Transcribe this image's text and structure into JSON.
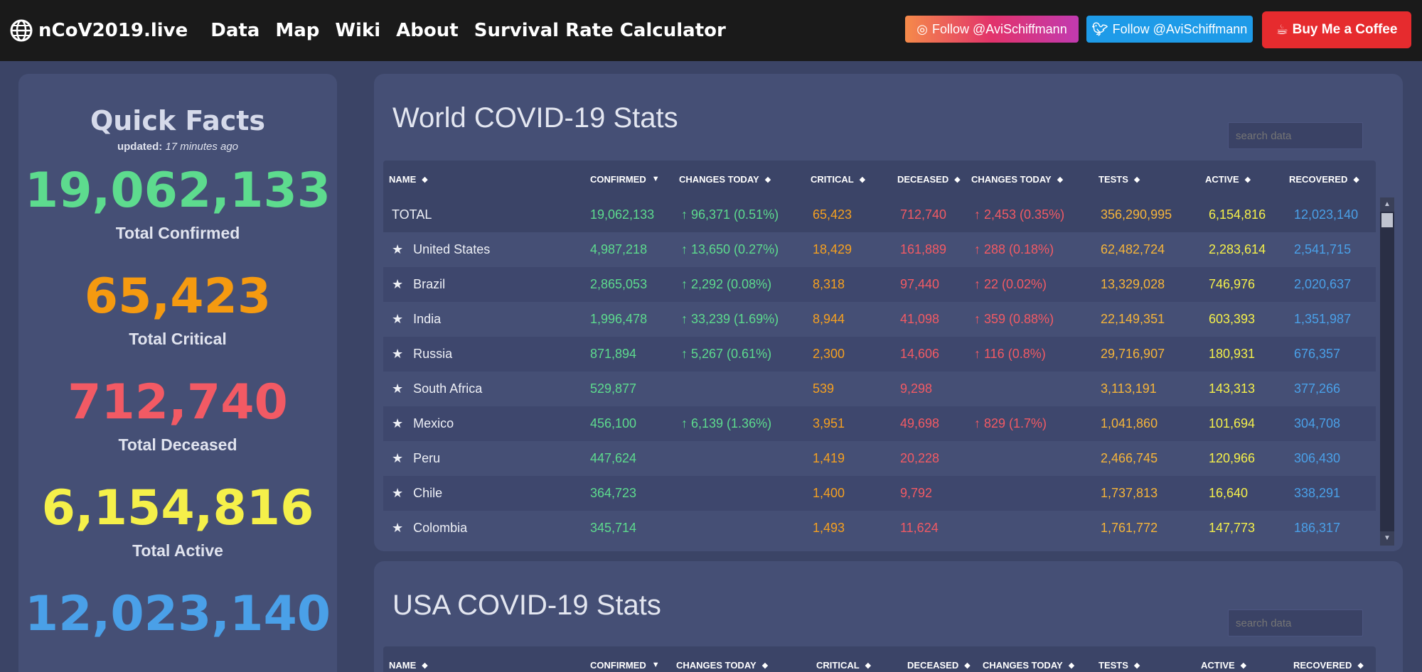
{
  "nav": {
    "brand": "nCoV2019.live",
    "links": [
      "Data",
      "Map",
      "Wiki",
      "About",
      "Survival Rate Calculator"
    ],
    "instagram_label": "Follow @AviSchiffmann",
    "twitter_label": "Follow @AviSchiffmann",
    "coffee_label": "Buy Me a Coffee"
  },
  "quick_facts": {
    "title": "Quick Facts",
    "updated_prefix": "updated:",
    "updated_value": "17 minutes ago",
    "facts": [
      {
        "value": "19,062,133",
        "label": "Total Confirmed",
        "color": "#5ddb8e"
      },
      {
        "value": "65,423",
        "label": "Total Critical",
        "color": "#f59a10"
      },
      {
        "value": "712,740",
        "label": "Total Deceased",
        "color": "#f25a64"
      },
      {
        "value": "6,154,816",
        "label": "Total Active",
        "color": "#f5f04a"
      },
      {
        "value": "12,023,140",
        "label": "",
        "color": "#4aa0e8"
      }
    ]
  },
  "world": {
    "title": "World COVID-19 Stats",
    "search_placeholder": "search data",
    "headers": [
      "NAME",
      "CONFIRMED",
      "CHANGES TODAY",
      "CRITICAL",
      "DECEASED",
      "CHANGES TODAY",
      "TESTS",
      "ACTIVE",
      "RECOVERED"
    ],
    "rows": [
      {
        "name": "TOTAL",
        "star": "",
        "confirmed": "19,062,133",
        "change": "↑ 96,371 (0.51%)",
        "critical": "65,423",
        "deceased": "712,740",
        "dchange": "↑ 2,453 (0.35%)",
        "tests": "356,290,995",
        "active": "6,154,816",
        "recovered": "12,023,140"
      },
      {
        "name": "United States",
        "star": "★",
        "confirmed": "4,987,218",
        "change": "↑ 13,650 (0.27%)",
        "critical": "18,429",
        "deceased": "161,889",
        "dchange": "↑ 288 (0.18%)",
        "tests": "62,482,724",
        "active": "2,283,614",
        "recovered": "2,541,715"
      },
      {
        "name": "Brazil",
        "star": "★",
        "confirmed": "2,865,053",
        "change": "↑ 2,292 (0.08%)",
        "critical": "8,318",
        "deceased": "97,440",
        "dchange": "↑ 22 (0.02%)",
        "tests": "13,329,028",
        "active": "746,976",
        "recovered": "2,020,637"
      },
      {
        "name": "India",
        "star": "★",
        "confirmed": "1,996,478",
        "change": "↑ 33,239 (1.69%)",
        "critical": "8,944",
        "deceased": "41,098",
        "dchange": "↑ 359 (0.88%)",
        "tests": "22,149,351",
        "active": "603,393",
        "recovered": "1,351,987"
      },
      {
        "name": "Russia",
        "star": "★",
        "confirmed": "871,894",
        "change": "↑ 5,267 (0.61%)",
        "critical": "2,300",
        "deceased": "14,606",
        "dchange": "↑ 116 (0.8%)",
        "tests": "29,716,907",
        "active": "180,931",
        "recovered": "676,357"
      },
      {
        "name": "South Africa",
        "star": "★",
        "confirmed": "529,877",
        "change": "",
        "critical": "539",
        "deceased": "9,298",
        "dchange": "",
        "tests": "3,113,191",
        "active": "143,313",
        "recovered": "377,266"
      },
      {
        "name": "Mexico",
        "star": "★",
        "confirmed": "456,100",
        "change": "↑ 6,139 (1.36%)",
        "critical": "3,951",
        "deceased": "49,698",
        "dchange": "↑ 829 (1.7%)",
        "tests": "1,041,860",
        "active": "101,694",
        "recovered": "304,708"
      },
      {
        "name": "Peru",
        "star": "★",
        "confirmed": "447,624",
        "change": "",
        "critical": "1,419",
        "deceased": "20,228",
        "dchange": "",
        "tests": "2,466,745",
        "active": "120,966",
        "recovered": "306,430"
      },
      {
        "name": "Chile",
        "star": "★",
        "confirmed": "364,723",
        "change": "",
        "critical": "1,400",
        "deceased": "9,792",
        "dchange": "",
        "tests": "1,737,813",
        "active": "16,640",
        "recovered": "338,291"
      },
      {
        "name": "Colombia",
        "star": "★",
        "confirmed": "345,714",
        "change": "",
        "critical": "1,493",
        "deceased": "11,624",
        "dchange": "",
        "tests": "1,761,772",
        "active": "147,773",
        "recovered": "186,317"
      }
    ]
  },
  "usa": {
    "title": "USA COVID-19 Stats",
    "search_placeholder": "search data",
    "headers": [
      "NAME",
      "CONFIRMED",
      "CHANGES TODAY",
      "CRITICAL",
      "DECEASED",
      "CHANGES TODAY",
      "TESTS",
      "ACTIVE",
      "RECOVERED"
    ]
  }
}
